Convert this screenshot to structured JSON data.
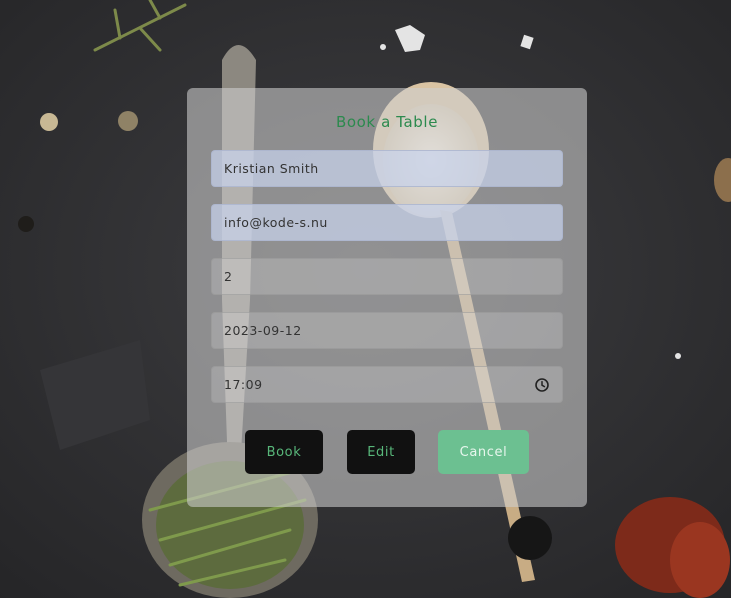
{
  "booking_form": {
    "title": "Book a Table",
    "name_value": "Kristian Smith",
    "email_value": "info@kode-s.nu",
    "guests_value": "2",
    "date_value": "2023-09-12",
    "time_value": "17:09",
    "book_label": "Book",
    "edit_label": "Edit",
    "cancel_label": "Cancel"
  },
  "colors": {
    "title_green": "#2c8a4e",
    "dark_button": "#111111",
    "cancel_button": "#6cc091",
    "autofill_blue": "#c8d2eb"
  },
  "icons": {
    "time_picker": "clock-icon"
  }
}
